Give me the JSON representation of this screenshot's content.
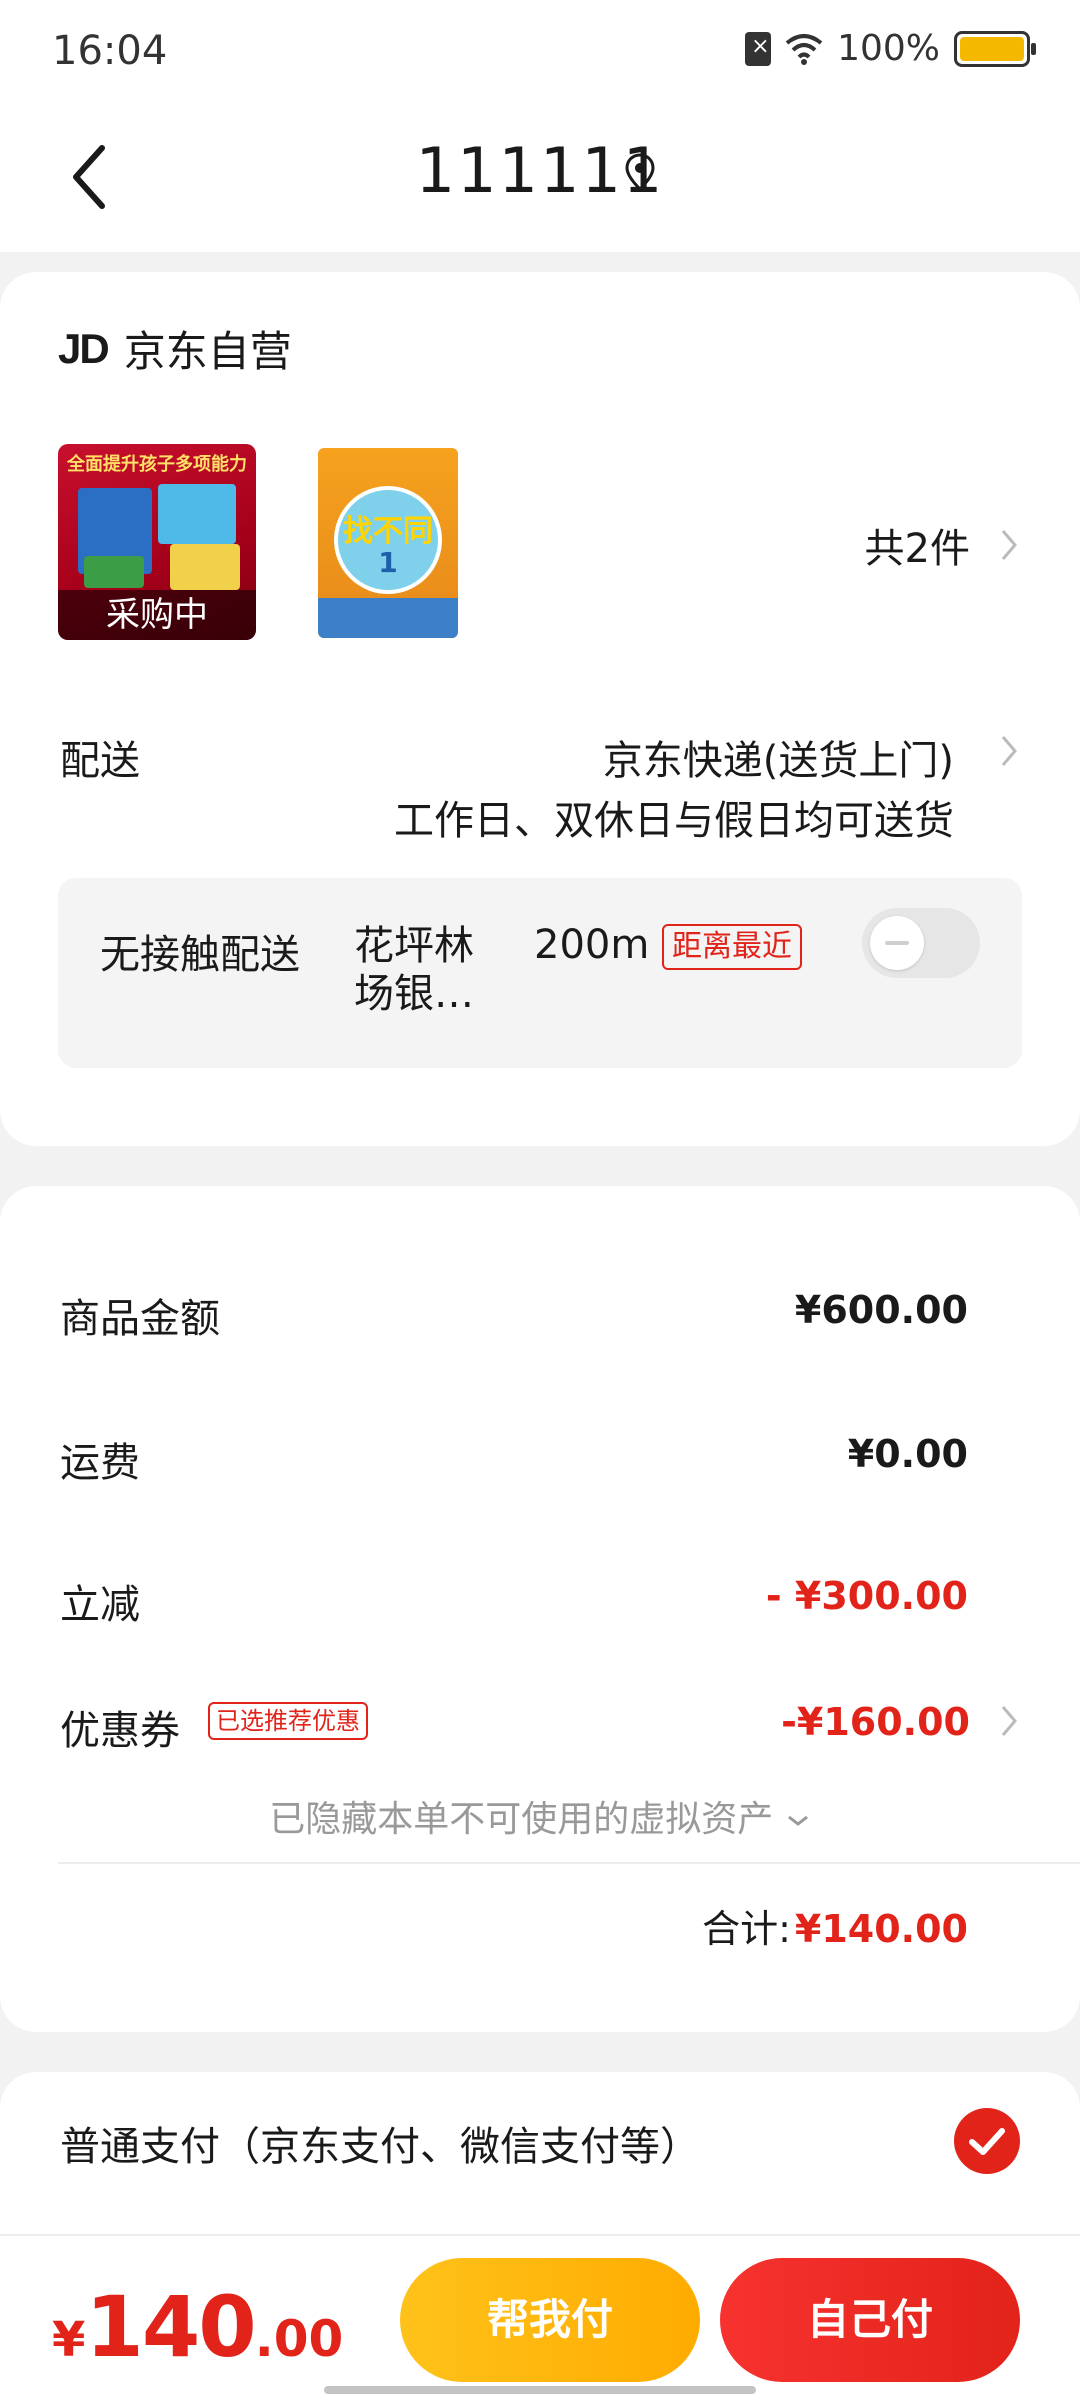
{
  "status_bar": {
    "time": "16:04",
    "battery_text": "100%",
    "icons": [
      "sim-icon",
      "wifi-icon",
      "battery-icon"
    ]
  },
  "header": {
    "title": "111111",
    "icons": [
      "back-arrow-icon",
      "location-pin-icon"
    ]
  },
  "order_card": {
    "shop_logo": "JD",
    "shop_name": "京东自营",
    "products": [
      {
        "headline": "全面提升孩子多项能力",
        "status": "采购中"
      },
      {
        "title": "找不同",
        "number": "1"
      }
    ],
    "item_count": "共2件",
    "delivery": {
      "label": "配送",
      "method": "京东快递(送货上门)",
      "note": "工作日、双休日与假日均可送货"
    },
    "contactless": {
      "label": "无接触配送",
      "location": "花坪林场银…",
      "distance": "200m",
      "badge": "距离最近",
      "enabled": false
    }
  },
  "price_card": {
    "goods_label": "商品金额",
    "goods_value": "¥600.00",
    "shipping_label": "运费",
    "shipping_value": "¥0.00",
    "discount_label": "立减",
    "discount_value": "- ¥300.00",
    "coupon_label": "优惠券",
    "coupon_badge": "已选推荐优惠",
    "coupon_value": "-¥160.00",
    "hidden_assets_text": "已隐藏本单不可使用的虚拟资产",
    "total_label": "合计:",
    "total_value": "¥140.00"
  },
  "payment_card": {
    "method": "普通支付（京东支付、微信支付等）",
    "selected": true
  },
  "bottom_bar": {
    "price_symbol": "¥",
    "price_integer": "140",
    "price_decimal": ".00",
    "help_pay_label": "帮我付",
    "self_pay_label": "自己付"
  },
  "colors": {
    "accent_red": "#e2231a",
    "accent_yellow": "#ffb400",
    "battery": "#f5b800"
  }
}
